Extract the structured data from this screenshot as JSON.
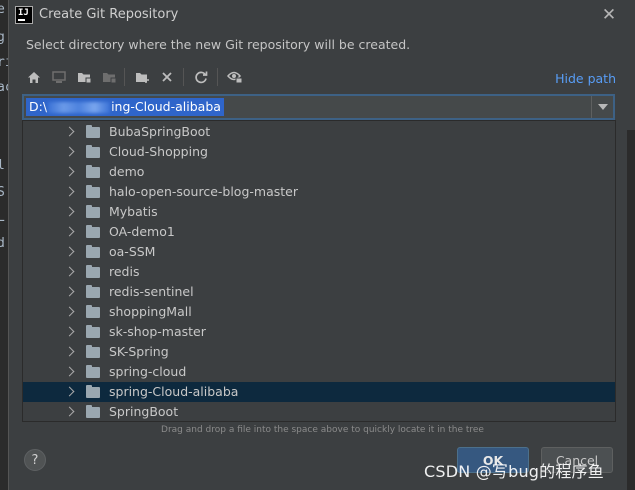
{
  "dialog": {
    "title": "Create Git Repository",
    "subtitle": "Select directory where the new Git repository will be created.",
    "close_icon": "close-icon"
  },
  "toolbar": {
    "buttons": [
      {
        "name": "home-icon",
        "enabled": true
      },
      {
        "name": "desktop-icon",
        "enabled": false
      },
      {
        "name": "project-folder-icon",
        "enabled": true
      },
      {
        "name": "module-folder-icon",
        "enabled": false
      },
      {
        "name": "new-folder-icon",
        "enabled": true
      },
      {
        "name": "delete-icon",
        "enabled": true
      },
      {
        "name": "refresh-icon",
        "enabled": true
      },
      {
        "name": "show-hidden-icon",
        "enabled": true
      }
    ],
    "hide_path_label": "Hide path"
  },
  "path": {
    "prefix": "D:\\",
    "suffix": "ing-Cloud-alibaba"
  },
  "tree": {
    "items": [
      {
        "label": "BubaSpringBoot",
        "selected": false
      },
      {
        "label": "Cloud-Shopping",
        "selected": false
      },
      {
        "label": "demo",
        "selected": false
      },
      {
        "label": "halo-open-source-blog-master",
        "selected": false
      },
      {
        "label": "Mybatis",
        "selected": false
      },
      {
        "label": "OA-demo1",
        "selected": false
      },
      {
        "label": "oa-SSM",
        "selected": false
      },
      {
        "label": "redis",
        "selected": false
      },
      {
        "label": "redis-sentinel",
        "selected": false
      },
      {
        "label": "shoppingMall",
        "selected": false
      },
      {
        "label": "sk-shop-master",
        "selected": false
      },
      {
        "label": "SK-Spring",
        "selected": false
      },
      {
        "label": "spring-cloud",
        "selected": false
      },
      {
        "label": "spring-Cloud-alibaba",
        "selected": true
      },
      {
        "label": "SpringBoot",
        "selected": false
      }
    ]
  },
  "hint": "Drag and drop a file into the space above to quickly locate it in the tree",
  "buttons": {
    "help": "?",
    "ok": "OK",
    "cancel": "Cancel"
  },
  "watermark": "CSDN @写bug的程序鱼",
  "colors": {
    "accent": "#589df6",
    "selection": "#2f65ca",
    "tree_selected": "#0d293e",
    "ok_button": "#365880"
  }
}
